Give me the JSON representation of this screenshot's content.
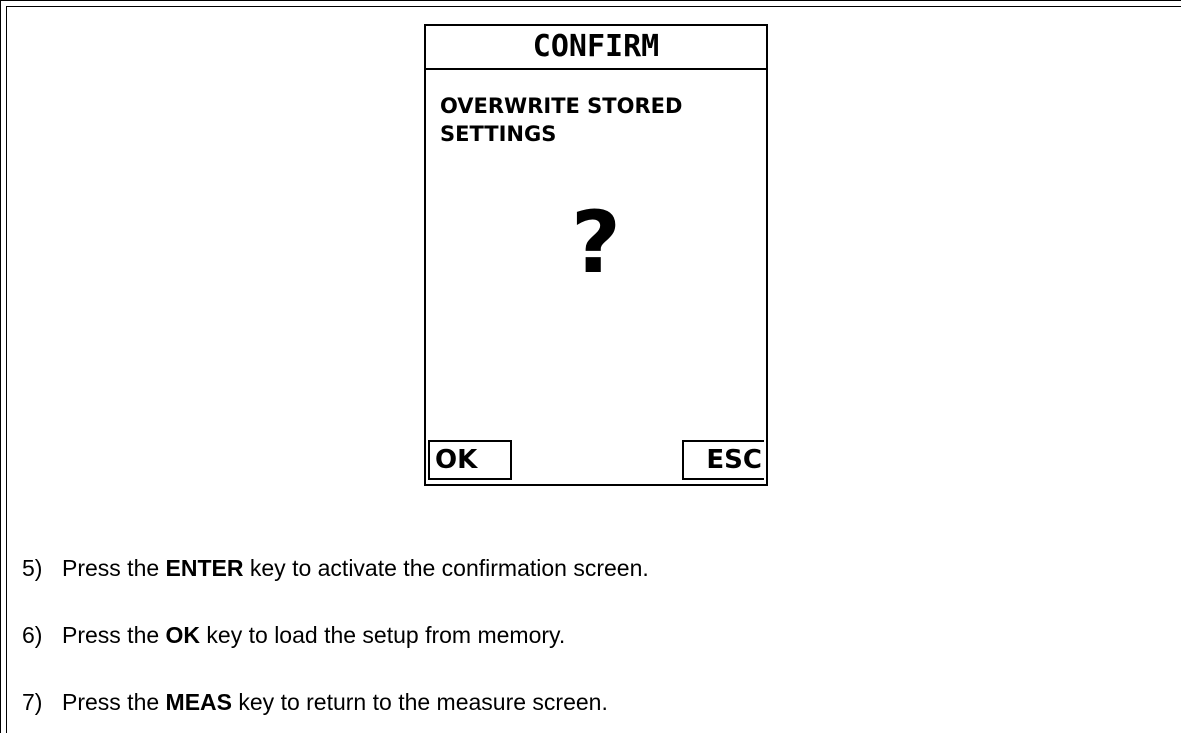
{
  "screen": {
    "title": "CONFIRM",
    "message_line1": "OVERWRITE STORED",
    "message_line2": "SETTINGS",
    "prompt_symbol": "?",
    "softkey_left": "OK",
    "softkey_right": "ESC"
  },
  "steps": [
    {
      "number": "5)",
      "before": "Press the ",
      "key": "ENTER",
      "after": " key to activate the confirmation screen."
    },
    {
      "number": "6)",
      "before": "Press the ",
      "key": "OK",
      "after": " key to load the setup from memory."
    },
    {
      "number": "7)",
      "before": "Press the ",
      "key": "MEAS",
      "after": " key to return to the measure screen."
    }
  ]
}
